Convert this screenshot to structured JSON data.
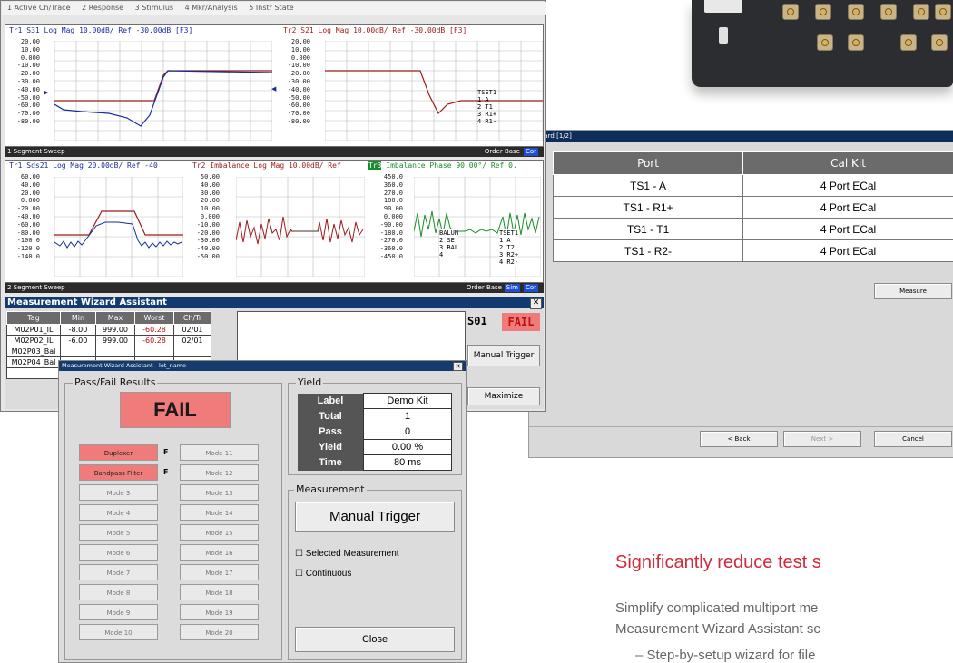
{
  "vna": {
    "menu": [
      "1 Active Ch/Trace",
      "2 Response",
      "3 Stimulus",
      "4 Mkr/Analysis",
      "5 Instr State"
    ],
    "ch1": {
      "trace1_label": "Tr1 S31 Log Mag 10.00dB/ Ref -30.00dB [F3]",
      "trace2_label": "Tr2 S21 Log Mag 10.00dB/ Ref -30.00dB [F3]",
      "yticks": [
        "20.00",
        "10.00",
        "0.000",
        "-10.00",
        "-20.00",
        "-30.00",
        "-40.00",
        "-50.00",
        "-60.00",
        "-70.00",
        "-80.00"
      ],
      "tset": [
        "TSET1",
        "1 A",
        "2 T1",
        "3 R1+",
        "4 R1-"
      ],
      "status_left": "1 Segment Sweep",
      "status_right": "Order Base",
      "status_cor": "Cor"
    },
    "ch2": {
      "trace1_label": "Tr1 Sds21 Log Mag 20.00dB/ Ref -40",
      "trace2_label": "Tr2 Imbalance Log Mag 10.00dB/ Ref",
      "trace3_tag": "Tr3",
      "trace3_label": " Imbalance Phase 90.00°/ Ref 0.",
      "yticks1": [
        "60.00",
        "40.00",
        "20.00",
        "0.000",
        "-20.00",
        "-40.00",
        "-60.00",
        "-80.00",
        "-100.0",
        "-120.0",
        "-140.0"
      ],
      "yticks2": [
        "50.00",
        "40.00",
        "30.00",
        "20.00",
        "10.00",
        "0.000",
        "-10.00",
        "-20.00",
        "-30.00",
        "-40.00",
        "-50.00"
      ],
      "yticks3": [
        "450.0",
        "360.0",
        "270.0",
        "180.0",
        "90.00",
        "0.000",
        "-90.00",
        "-180.0",
        "-270.0",
        "-360.0",
        "-450.0"
      ],
      "balun": [
        "BALUN",
        "2 SE",
        "3 BAL",
        "4"
      ],
      "tset": [
        "TSET1",
        "1 A",
        "2 T2",
        "3 R2+",
        "4 R2-"
      ],
      "status_left": "2 Segment Sweep",
      "status_right": "Order Base",
      "status_sim": "Sim",
      "status_cor": "Cor"
    },
    "mwa": {
      "title": "Measurement Wizard Assistant",
      "headers": [
        "Tag",
        "Min",
        "Max",
        "Worst",
        "Ch/Tr"
      ],
      "rows": [
        [
          "M02P01_IL",
          "-8.00",
          "999.00",
          "-60.28",
          "02/01"
        ],
        [
          "M02P02_IL",
          "-6.00",
          "999.00",
          "-60.28",
          "02/01"
        ],
        [
          "M02P03_Bal",
          "",
          "",
          "",
          ""
        ],
        [
          "M02P04_Bal",
          "",
          "",
          "",
          ""
        ]
      ],
      "s01": "S01",
      "fail": "FAIL",
      "manual_trigger": "Manual Trigger",
      "maximize": "Maximize"
    }
  },
  "calwizard": {
    "title": "Wizard [1/2]",
    "headers": [
      "Port",
      "Cal Kit"
    ],
    "rows": [
      [
        "TS1 - A",
        "4 Port ECal"
      ],
      [
        "TS1 - R1+",
        "4 Port ECal"
      ],
      [
        "TS1 - T1",
        "4 Port ECal"
      ],
      [
        "TS1 - R2-",
        "4 Port ECal"
      ]
    ],
    "measure": "Measure",
    "back": "< Back",
    "next": "Next >",
    "cancel": "Cancel"
  },
  "passfail": {
    "title": "Measurement Wizard Assistant - lot_name",
    "results_label": "Pass/Fail Results",
    "fail": "FAIL",
    "modes_left": [
      "Duplexer",
      "Bandpass Filter",
      "Mode 3",
      "Mode 4",
      "Mode 5",
      "Mode 6",
      "Mode 7",
      "Mode 8",
      "Mode 9",
      "Mode 10"
    ],
    "modes_left_status": [
      "F",
      "F",
      "",
      "",
      "",
      "",
      "",
      "",
      "",
      ""
    ],
    "modes_right": [
      "Mode 11",
      "Mode 12",
      "Mode 13",
      "Mode 14",
      "Mode 15",
      "Mode 16",
      "Mode 17",
      "Mode 18",
      "Mode 19",
      "Mode 20"
    ],
    "yield_label": "Yield",
    "yield": {
      "label_k": "Label",
      "label_v": "Demo Kit",
      "total_k": "Total",
      "total_v": "1",
      "pass_k": "Pass",
      "pass_v": "0",
      "yield_k": "Yield",
      "yield_v": "0.00 %",
      "time_k": "Time",
      "time_v": "80 ms"
    },
    "measurement_label": "Measurement",
    "manual_trigger": "Manual Trigger",
    "selected": "Selected Measurement",
    "continuous": "Continuous",
    "close": "Close"
  },
  "marketing": {
    "headline": "Significantly reduce test s",
    "line1": "Simplify complicated multiport me",
    "line2": "Measurement Wizard Assistant sc",
    "line3": "–  Step-by-setup wizard for file"
  },
  "colors": {
    "accent_red": "#d32a3a",
    "trace_blue": "#1a2c9c",
    "trace_red": "#9c1a1a",
    "trace_green": "#1a8c2c",
    "fail_bg": "#f07b7b"
  }
}
